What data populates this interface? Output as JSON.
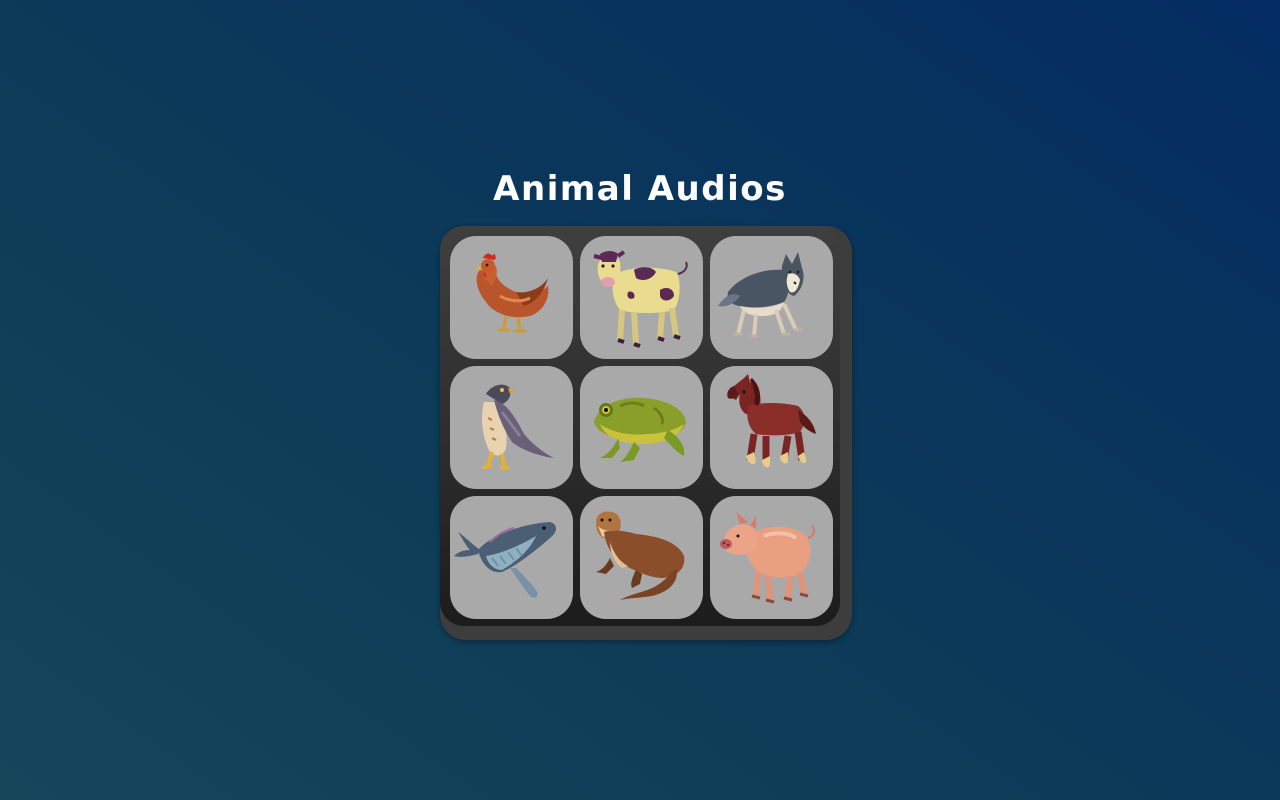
{
  "page": {
    "title": "Animal Audios"
  },
  "colors": {
    "background_start": "#15465a",
    "background_end": "#042c62",
    "board": "#3d3d3d",
    "tile": "#a9a9a9",
    "title_text": "#ffffff"
  },
  "tiles": [
    {
      "animal": "chicken",
      "icon": "chicken-icon"
    },
    {
      "animal": "cow",
      "icon": "cow-icon"
    },
    {
      "animal": "wolf",
      "icon": "wolf-icon"
    },
    {
      "animal": "hawk",
      "icon": "hawk-icon"
    },
    {
      "animal": "frog",
      "icon": "frog-icon"
    },
    {
      "animal": "horse",
      "icon": "horse-icon"
    },
    {
      "animal": "whale",
      "icon": "whale-icon"
    },
    {
      "animal": "otter",
      "icon": "otter-icon"
    },
    {
      "animal": "pig",
      "icon": "pig-icon"
    }
  ]
}
